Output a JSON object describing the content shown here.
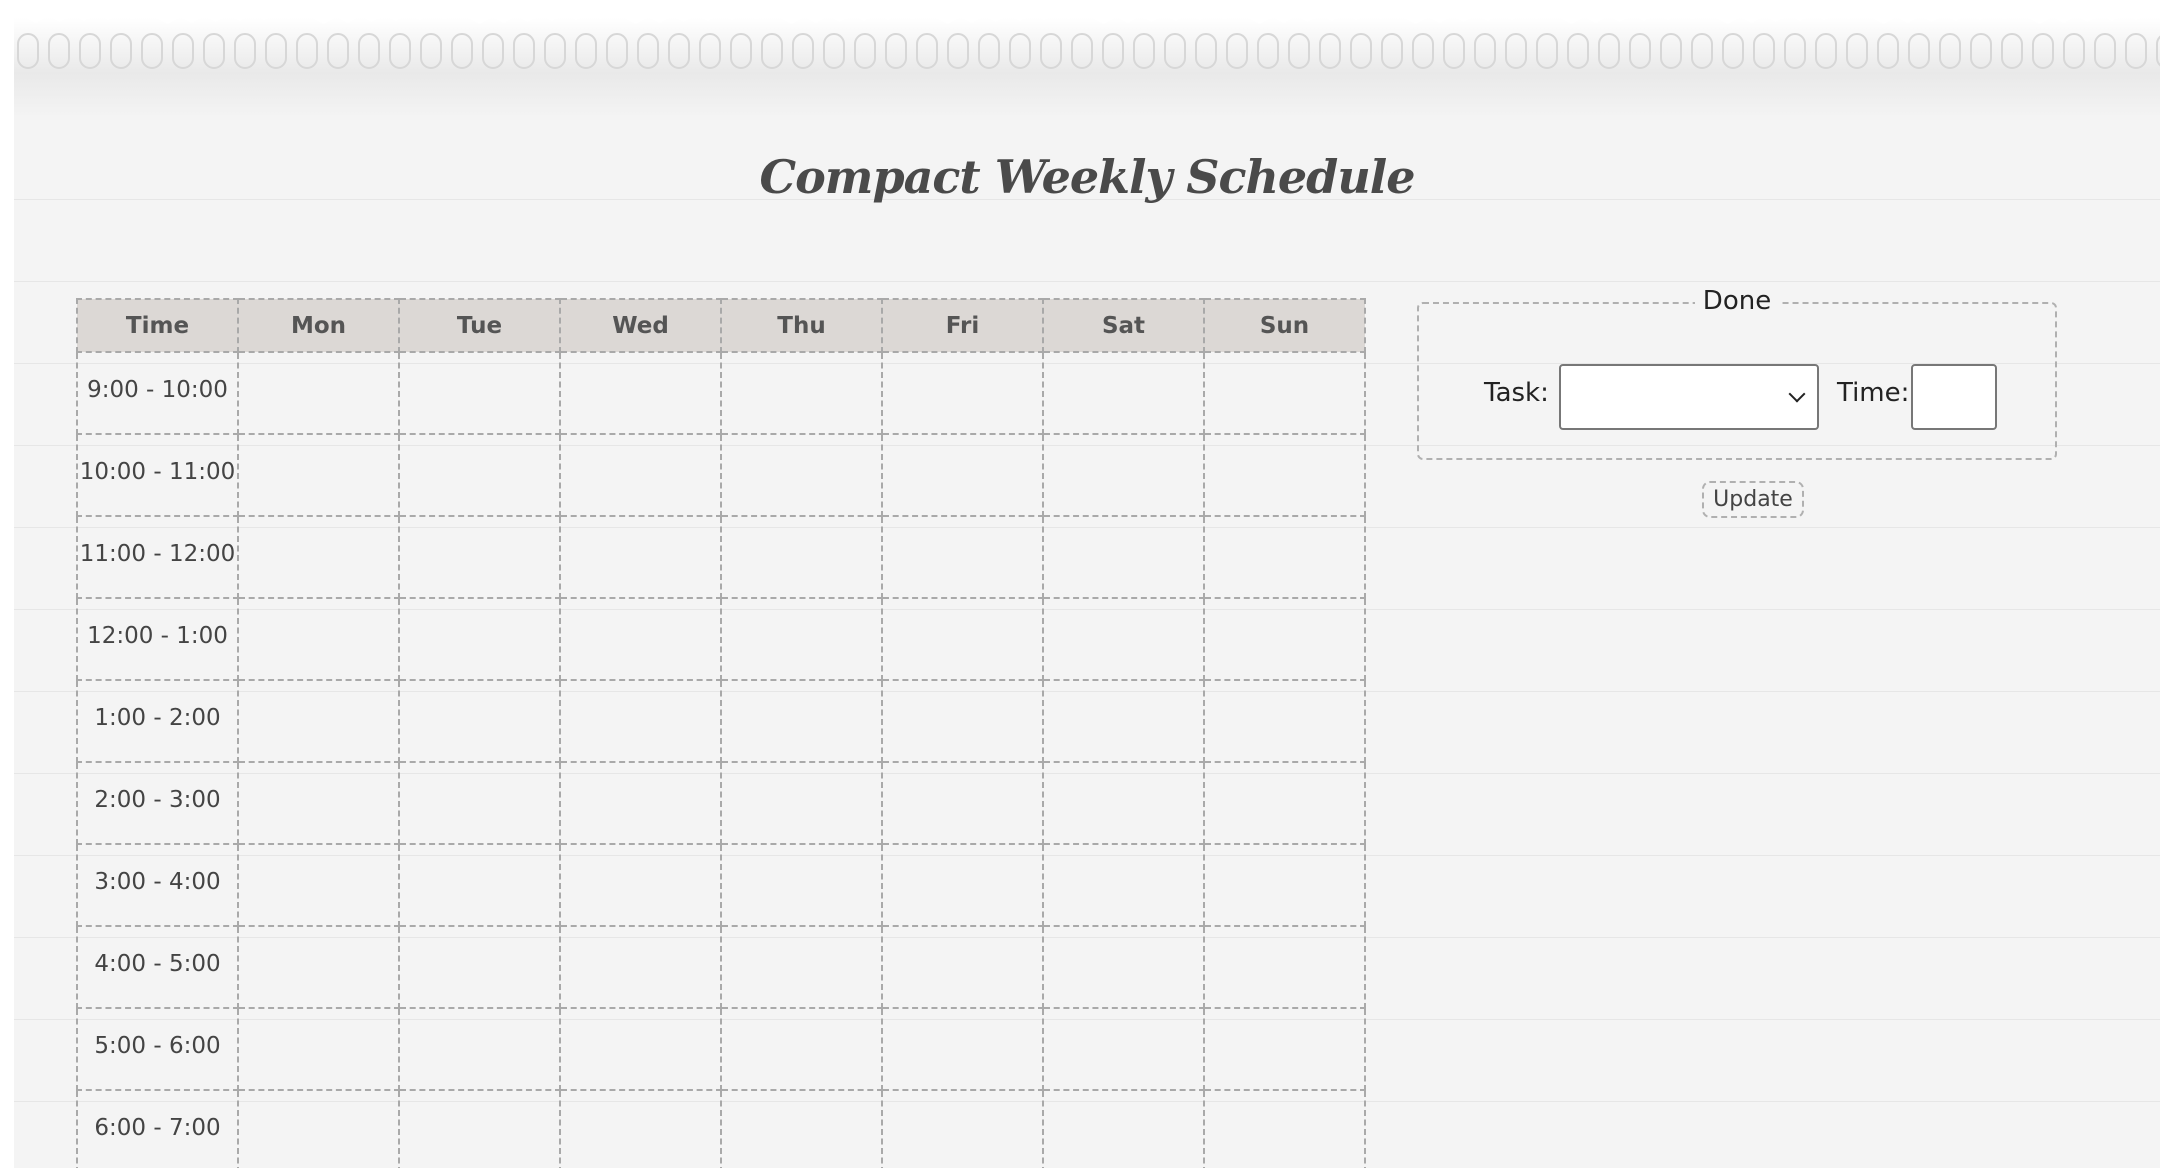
{
  "title": "Compact Weekly Schedule",
  "schedule": {
    "headers": [
      "Time",
      "Mon",
      "Tue",
      "Wed",
      "Thu",
      "Fri",
      "Sat",
      "Sun"
    ],
    "time_slots": [
      "9:00 - 10:00",
      "10:00 - 11:00",
      "11:00 - 12:00",
      "12:00 - 1:00",
      "1:00 - 2:00",
      "2:00 - 3:00",
      "3:00 - 4:00",
      "4:00 - 5:00",
      "5:00 - 6:00",
      "6:00 - 7:00"
    ]
  },
  "form": {
    "legend": "Done",
    "task_label": "Task:",
    "task_value": "",
    "time_label": "Time:",
    "time_value": "",
    "update_label": "Update"
  },
  "colors": {
    "page_background": "#f4f4f4",
    "header_background": "#dcd8d5",
    "border": "#a9a9a9"
  }
}
